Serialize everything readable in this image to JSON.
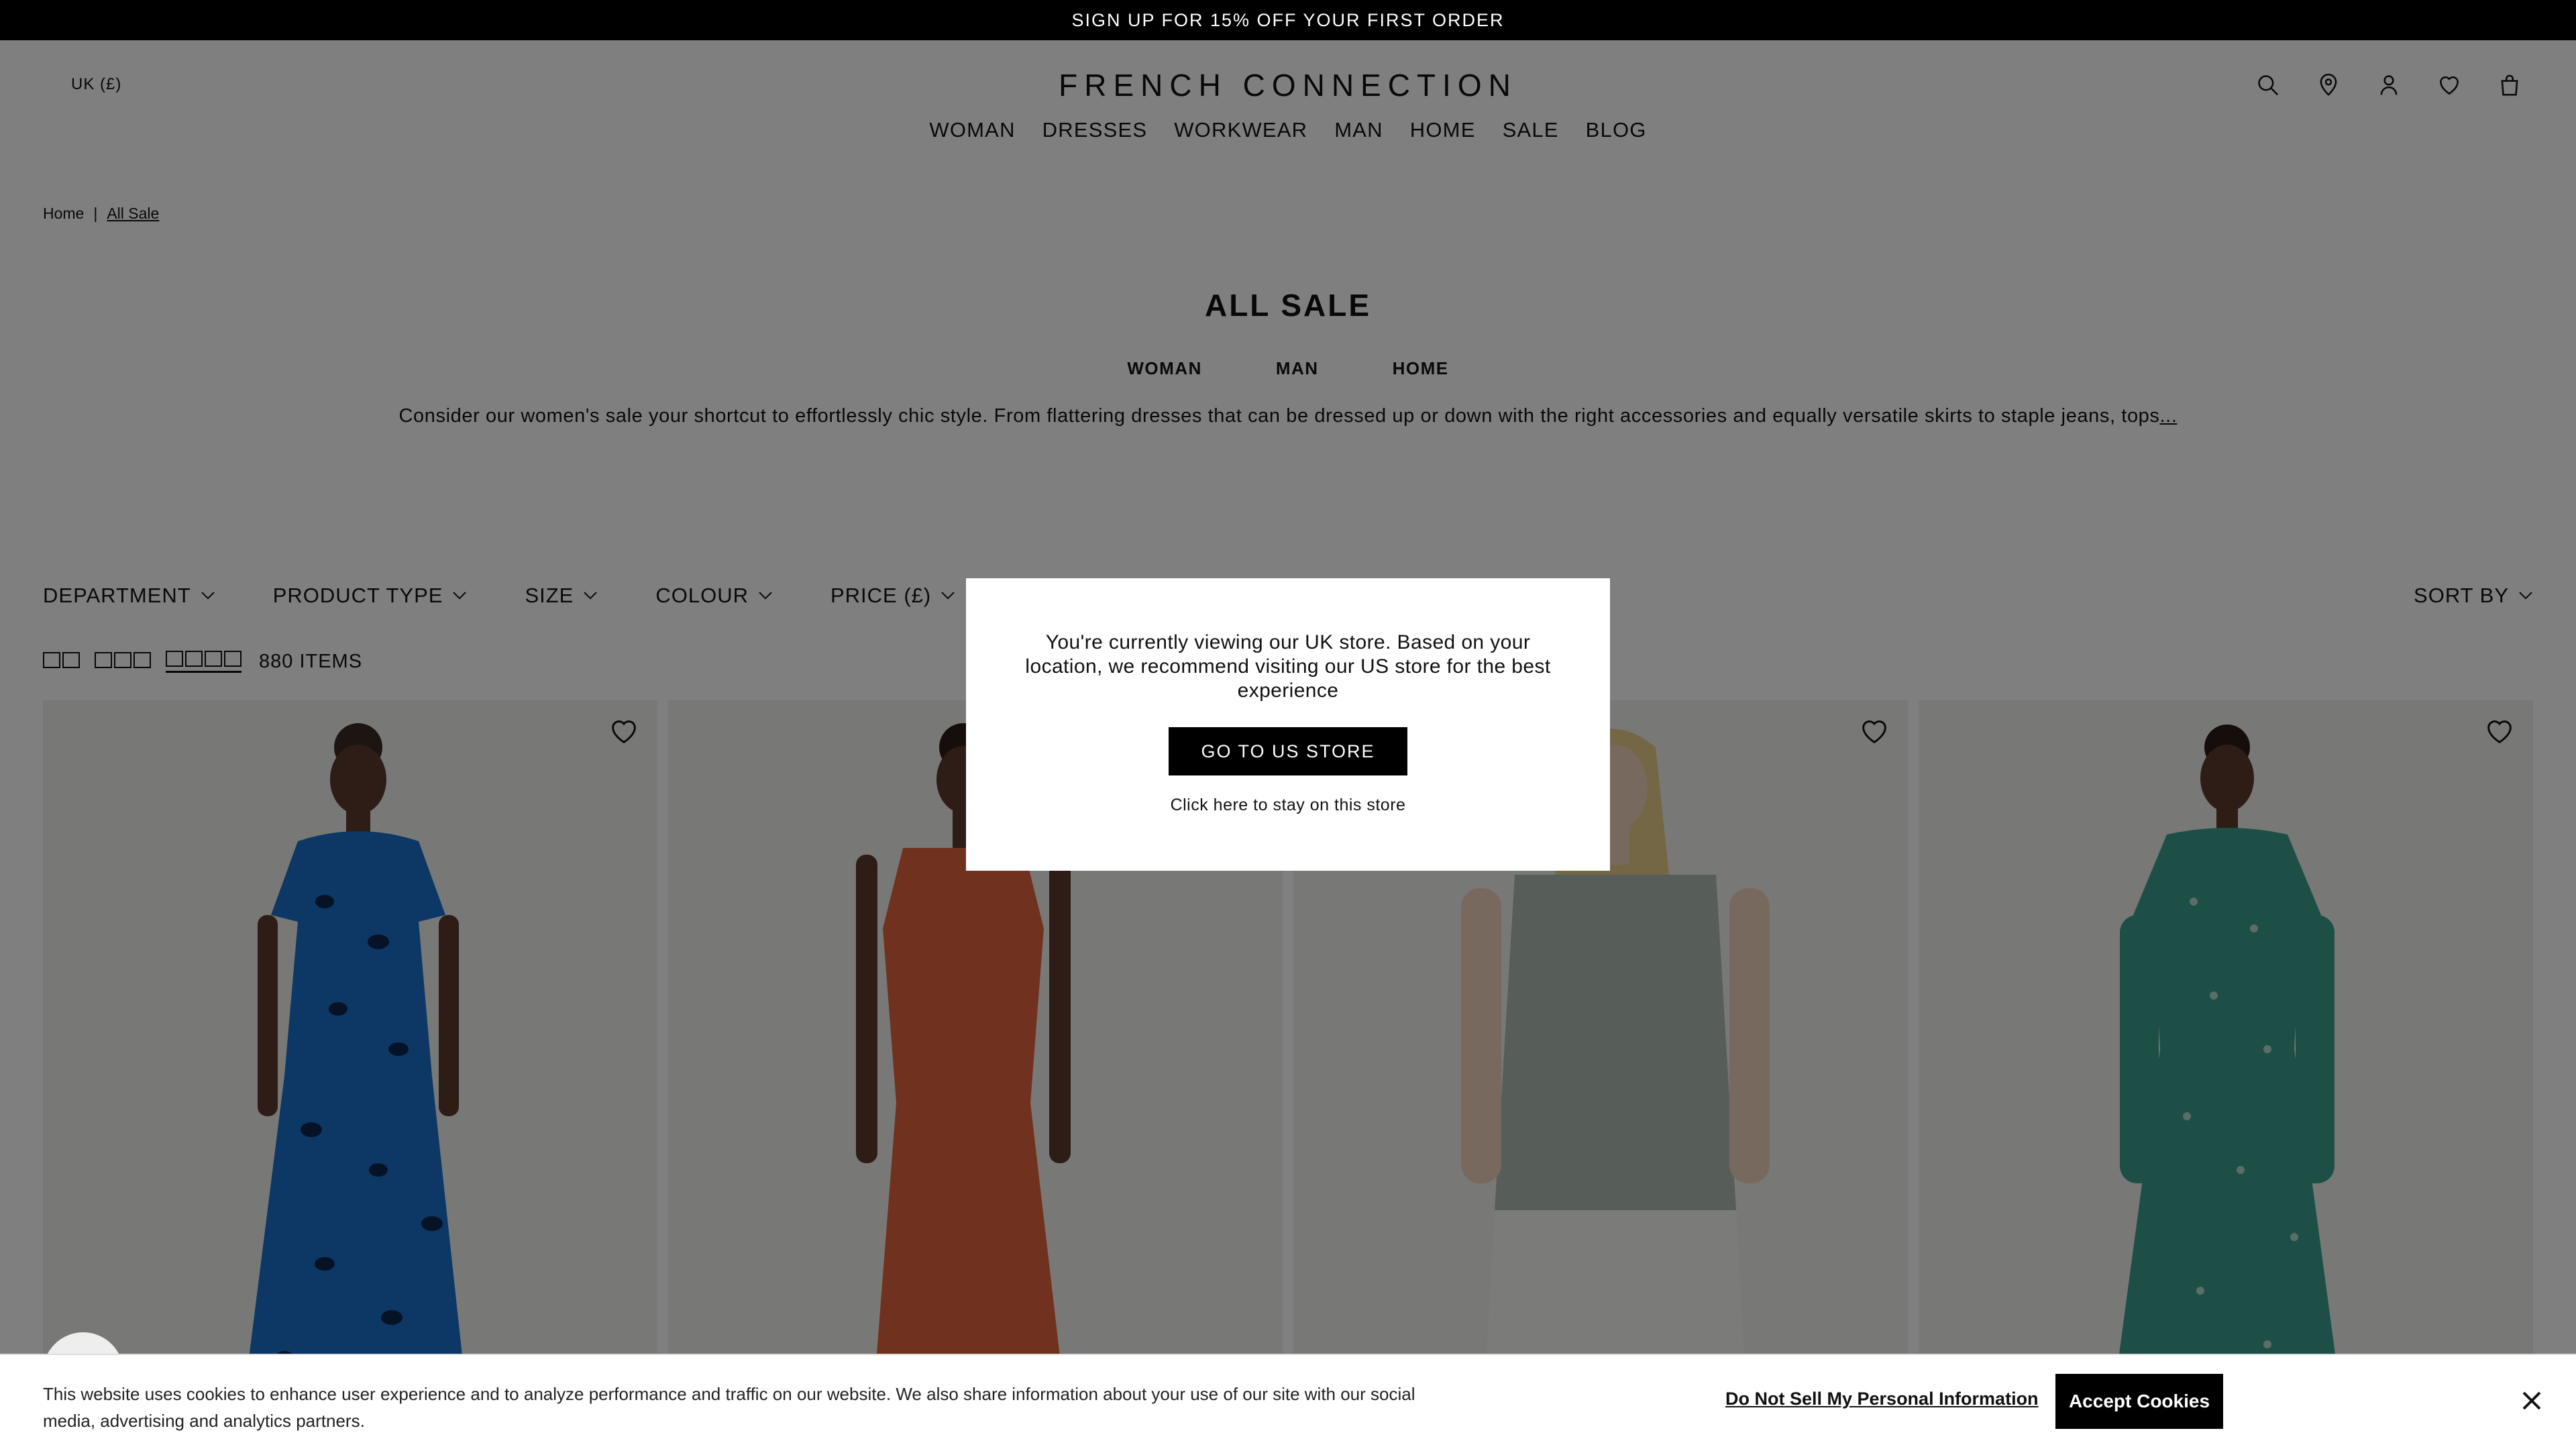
{
  "promo": {
    "text": "SIGN UP FOR 15% OFF YOUR FIRST ORDER"
  },
  "header": {
    "region": "UK (£)",
    "logo": "FRENCH CONNECTION",
    "nav": [
      "WOMAN",
      "DRESSES",
      "WORKWEAR",
      "MAN",
      "HOME",
      "SALE",
      "BLOG"
    ],
    "icons": [
      "search-icon",
      "location-icon",
      "account-icon",
      "wishlist-icon",
      "bag-icon"
    ]
  },
  "breadcrumb": {
    "home": "Home",
    "separator": "|",
    "current": "All Sale"
  },
  "hero": {
    "title": "ALL SALE",
    "categories": [
      "WOMAN",
      "MAN",
      "HOME"
    ],
    "description": "Consider our women's sale your shortcut to effortlessly chic style. From flattering dresses that can be dressed up or down with the right accessories and equally versatile skirts to staple jeans, tops",
    "more": "..."
  },
  "filters": {
    "items": [
      "DEPARTMENT",
      "PRODUCT TYPE",
      "SIZE",
      "COLOUR",
      "PRICE (£)"
    ],
    "sort": "SORT BY"
  },
  "listing": {
    "count": "880 ITEMS",
    "grid_options": [
      2,
      3,
      4
    ],
    "active_grid": 4
  },
  "products": [
    {
      "dress_color": "#1a6fc9",
      "pattern": "spots"
    },
    {
      "dress_color": "#e0653f",
      "pattern": "plain"
    },
    {
      "dress_color": "#aebcb4",
      "pattern": "plain"
    },
    {
      "dress_color": "#3a9e8f",
      "pattern": "print"
    }
  ],
  "modal": {
    "message": "You're currently viewing our UK store. Based on your location, we recommend visiting our US store for the best experience",
    "button": "GO TO US STORE",
    "stay_link": "Click here to stay on this store"
  },
  "cookie": {
    "text": "This website uses cookies to enhance user experience and to analyze performance and traffic on our website. We also share information about your use of our site with our social media, advertising and analytics partners.",
    "do_not_sell": "Do Not Sell My Personal Information",
    "accept": "Accept Cookies"
  }
}
